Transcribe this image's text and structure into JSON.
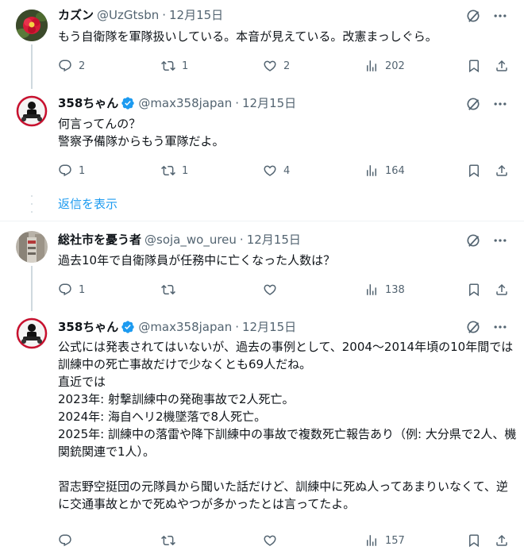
{
  "tweets": [
    {
      "name": "カズン",
      "handle": "@UzGtsbn",
      "date": "12月15日",
      "text": "もう自衛隊を軍隊扱いしている。本音が見えている。改憲まっしぐら。",
      "replies": "2",
      "retweets": "1",
      "likes": "2",
      "views": "202"
    },
    {
      "name": "358ちゃん",
      "handle": "@max358japan",
      "date": "12月15日",
      "text": "何言ってんの？\n警察予備隊からもう軍隊だよ。",
      "replies": "1",
      "retweets": "1",
      "likes": "4",
      "views": "164"
    },
    {
      "name": "総社市を憂う者",
      "handle": "@soja_wo_ureu",
      "date": "12月15日",
      "text": "過去10年で自衛隊員が任務中に亡くなった人数は？",
      "replies": "1",
      "retweets": "",
      "likes": "",
      "views": "138"
    },
    {
      "name": "358ちゃん",
      "handle": "@max358japan",
      "date": "12月15日",
      "text": "公式には発表されてはいないが、過去の事例として、2004〜2014年頃の10年間では訓練中の死亡事故だけで少なくとも69人だね。\n直近では\n2023年: 射撃訓練中の発砲事故で2人死亡。\n2024年: 海自ヘリ2機墜落で8人死亡。\n2025年: 訓練中の落雷や降下訓練中の事故で複数死亡報告あり（例: 大分県で2人、機関銃関連で1人）。\n\n習志野空挺団の元隊員から聞いた話だけど、訓練中に死ぬ人ってあまりいなくて、逆に交通事故とかで死ぬやつが多かったとは言ってたよ。",
      "replies": "",
      "retweets": "",
      "likes": "",
      "views": "157"
    }
  ],
  "show_replies_label": "返信を表示",
  "colors": {
    "accent": "#1d9bf0",
    "muted": "#536471",
    "text": "#0f1419",
    "border": "#eff3f4"
  }
}
